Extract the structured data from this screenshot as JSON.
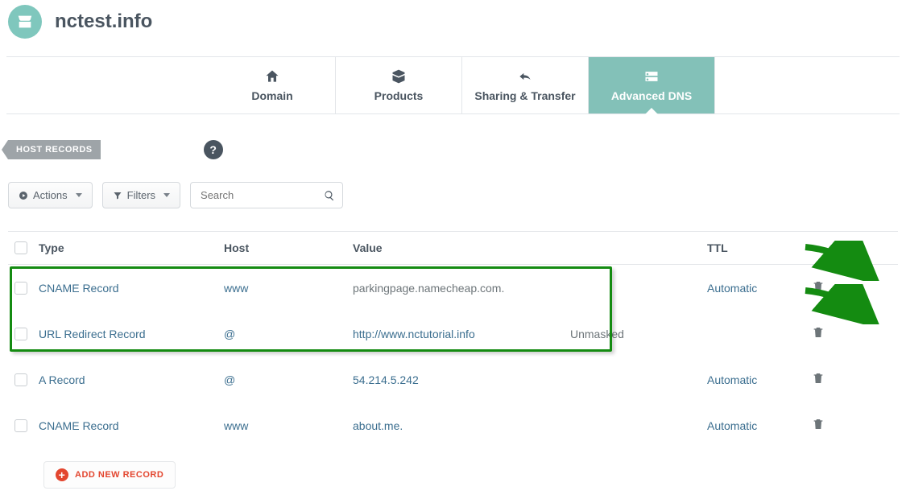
{
  "header": {
    "domain_title": "nctest.info"
  },
  "tabs": {
    "domain": "Domain",
    "products": "Products",
    "sharing": "Sharing & Transfer",
    "advanced_dns": "Advanced DNS"
  },
  "section": {
    "label": "HOST RECORDS",
    "help": "?"
  },
  "toolbar": {
    "actions": "Actions",
    "filters": "Filters",
    "search_placeholder": "Search"
  },
  "table": {
    "headers": {
      "type": "Type",
      "host": "Host",
      "value": "Value",
      "ttl": "TTL"
    },
    "rows": [
      {
        "type": "CNAME Record",
        "host": "www",
        "value": "parkingpage.namecheap.com.",
        "extra": "",
        "ttl": "Automatic"
      },
      {
        "type": "URL Redirect Record",
        "host": "@",
        "value": "http://www.nctutorial.info",
        "extra": "Unmasked",
        "ttl": ""
      },
      {
        "type": "A Record",
        "host": "@",
        "value": "54.214.5.242",
        "extra": "",
        "ttl": "Automatic"
      },
      {
        "type": "CNAME Record",
        "host": "www",
        "value": "about.me.",
        "extra": "",
        "ttl": "Automatic"
      }
    ]
  },
  "add_record": "ADD NEW RECORD"
}
